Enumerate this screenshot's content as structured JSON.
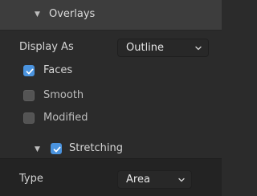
{
  "panel": {
    "title": "Overlays",
    "header_arrow_icon": "disclosure-triangle-down-icon"
  },
  "display_as": {
    "label": "Display As",
    "value": "Outline"
  },
  "checkboxes": [
    {
      "label": "Faces",
      "checked": true
    },
    {
      "label": "Smooth",
      "checked": false
    },
    {
      "label": "Modified",
      "checked": false
    }
  ],
  "stretching": {
    "label": "Stretching",
    "checked": true,
    "expanded": true
  },
  "type": {
    "label": "Type",
    "value": "Area"
  },
  "colors": {
    "accent": "#4a93de",
    "panel_bg": "#2b2b2b",
    "header_bg": "#3d3d3d"
  }
}
